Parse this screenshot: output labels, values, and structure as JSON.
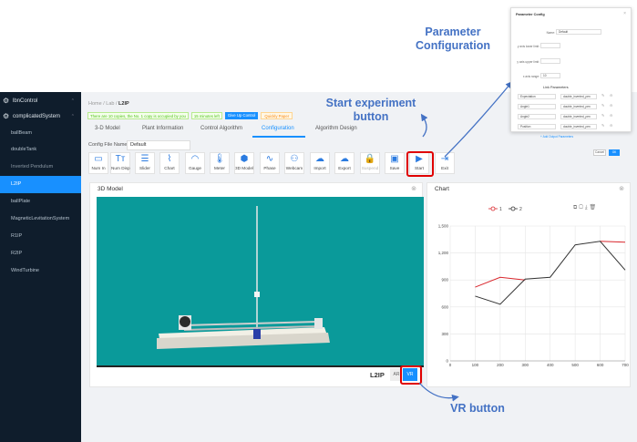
{
  "sidebar": {
    "group_top": "lbnControl",
    "group_main": "complicatedSystem",
    "items": [
      "ballBeam",
      "doubleTank",
      "Inverted Pendulum",
      "L2IP",
      "ballPlate",
      "MagneticLevitationSystem",
      "R1IP",
      "R2IP",
      "WindTurbine"
    ],
    "active_index": 3
  },
  "breadcrumb": {
    "home": "Home",
    "lab": "Lab",
    "current": "L2IP",
    "sep": "/"
  },
  "status": {
    "notice": "There are 10 copies, the No. 1 copy is occupied by you",
    "time_left": "15 minutes left",
    "give_up": "Give Up Control",
    "quickly_paper": "Quickly Paper"
  },
  "tabs": [
    "3-D Model",
    "Plant Information",
    "Control Algorithm",
    "Configuration",
    "Algorithm Design"
  ],
  "active_tab": 3,
  "config": {
    "label": "Config File Name",
    "value": "Default"
  },
  "toolbar": [
    {
      "label": "Num In",
      "icon": "numeric-input-icon",
      "glyph": "▭"
    },
    {
      "label": "Num Disp",
      "icon": "text-display-icon",
      "glyph": "Tт"
    },
    {
      "label": "Slider",
      "icon": "slider-icon",
      "glyph": "☰"
    },
    {
      "label": "Chart",
      "icon": "chart-icon",
      "glyph": "⌇"
    },
    {
      "label": "Gauge",
      "icon": "gauge-icon",
      "glyph": "◠"
    },
    {
      "label": "Meter",
      "icon": "thermometer-icon",
      "glyph": "🌡"
    },
    {
      "label": "3D Model",
      "icon": "cubes-icon",
      "glyph": "⬢"
    },
    {
      "label": "Phase",
      "icon": "wave-icon",
      "glyph": "∿"
    },
    {
      "label": "Webcam",
      "icon": "user-icon",
      "glyph": "⚇"
    },
    {
      "label": "Import",
      "icon": "cloud-upload-icon",
      "glyph": "☁"
    },
    {
      "label": "Export",
      "icon": "cloud-download-icon",
      "glyph": "☁"
    },
    {
      "label": "Suspend",
      "icon": "lock-icon",
      "glyph": "🔒"
    },
    {
      "label": "Save",
      "icon": "save-icon",
      "glyph": "▣"
    },
    {
      "label": "Start",
      "icon": "play-icon",
      "glyph": "▶"
    },
    {
      "label": "Exit",
      "icon": "exit-icon",
      "glyph": "⇥"
    }
  ],
  "model_panel": {
    "title": "3D Model",
    "model_name": "L2IP",
    "ar": "AR",
    "vr": "VR"
  },
  "chart_panel": {
    "title": "Chart"
  },
  "annotations": {
    "param_config_1": "Parameter",
    "param_config_2": "Configuration",
    "start_1": "Start experiment",
    "start_2": "button",
    "vr": "VR button"
  },
  "popup": {
    "title": "Parameter Config",
    "name_label": "Name:",
    "name_value": "Default",
    "ylow_label": "y axis lower limit:",
    "yup_label": "y axis upper limit:",
    "xrange_label": "x axis range:",
    "xrange_value": "10",
    "link_title": "Link Parameters",
    "links": [
      {
        "name": "Expectation",
        "value": "double_inverted_pen"
      },
      {
        "name": "Angle1",
        "value": "double_inverted_pen"
      },
      {
        "name": "Angle2",
        "value": "double_inverted_pen"
      },
      {
        "name": "Position",
        "value": "double_inverted_pen"
      }
    ],
    "add": "+ Add Output Parameters",
    "cancel": "Cancel",
    "ok": "OK"
  },
  "colors": {
    "accent": "#1890ff",
    "sidebar": "#0f1d2c",
    "scene": "#0a9a9a",
    "highlight": "#e00000",
    "annotation": "#4472c4",
    "series1": "#d9262c",
    "series2": "#333333"
  },
  "chart_data": {
    "type": "line",
    "x": [
      100,
      200,
      300,
      400,
      500,
      600,
      700
    ],
    "series": [
      {
        "name": "1",
        "values": [
          820,
          930,
          900,
          null,
          null,
          1330,
          1320
        ]
      },
      {
        "name": "2",
        "values": [
          720,
          630,
          910,
          930,
          1290,
          1330,
          1010
        ]
      }
    ],
    "xlim": [
      0,
      700
    ],
    "ylim": [
      0,
      1500
    ],
    "xticks": [
      0,
      100,
      200,
      300,
      400,
      500,
      600,
      700
    ],
    "yticks": [
      0,
      300,
      600,
      900,
      1200,
      1500
    ],
    "grid": true,
    "legend": "top"
  }
}
